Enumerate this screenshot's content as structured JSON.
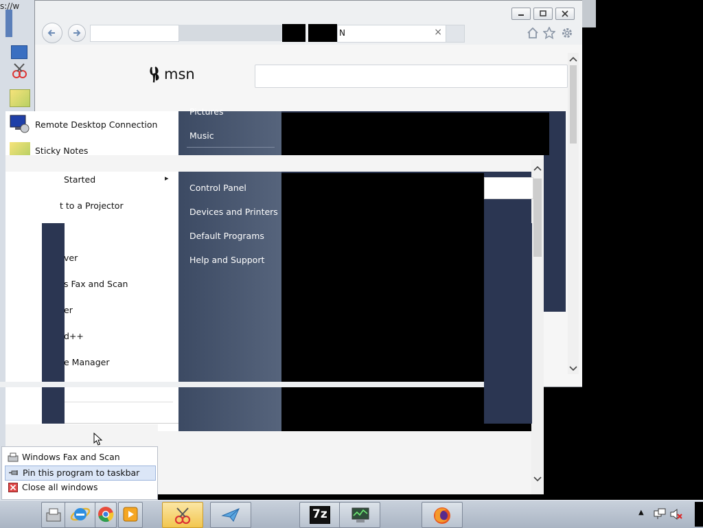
{
  "address_fragment": "s://w",
  "browser": {
    "tab_title_fragment": "N",
    "tab_close_glyph": "×",
    "brand": "msn"
  },
  "start_menu": {
    "programs": [
      {
        "label": "Remote Desktop Connection",
        "icon": "remote-desktop-icon"
      },
      {
        "label": "Sticky Notes",
        "icon": "sticky-notes-icon"
      },
      {
        "label": "Started",
        "icon": "getting-started-icon",
        "has_submenu": true
      },
      {
        "label": "t to a Projector",
        "icon": "projector-icon"
      },
      {
        "label": "ver",
        "icon": "program-icon"
      },
      {
        "label": "s Fax and Scan",
        "icon": "fax-icon"
      },
      {
        "label": "er",
        "icon": "program-icon"
      },
      {
        "label": "d++",
        "icon": "program-icon"
      },
      {
        "label": "e Manager",
        "icon": "program-icon"
      }
    ],
    "submenu_arrow": "▸",
    "places": [
      {
        "label": "Pictures"
      },
      {
        "label": "Music"
      },
      {
        "label": "Control Panel"
      },
      {
        "label": "Devices and Printers"
      },
      {
        "label": "Default Programs"
      },
      {
        "label": "Help and Support"
      }
    ]
  },
  "jump_list": {
    "items": [
      {
        "label": "Windows Fax and Scan",
        "icon": "fax-icon",
        "highlighted": false
      },
      {
        "label": "Pin this program to taskbar",
        "icon": "pin-icon",
        "highlighted": true
      },
      {
        "label": "Close all windows",
        "icon": "close-icon",
        "highlighted": false
      }
    ]
  },
  "taskbar": {
    "apps": [
      {
        "name": "fax-scan",
        "icon": "fax-icon",
        "active": false
      },
      {
        "name": "internet-explorer",
        "icon": "ie-icon",
        "active": false
      },
      {
        "name": "chrome",
        "icon": "chrome-icon",
        "active": false
      },
      {
        "name": "media-player",
        "icon": "media-player-icon",
        "active": false
      },
      {
        "name": "snipping-tool",
        "icon": "snipping-tool-icon",
        "active": true
      },
      {
        "name": "paper-plane",
        "icon": "paper-plane-icon",
        "active": false
      },
      {
        "name": "7-zip",
        "icon": "7zip-icon",
        "active": false
      },
      {
        "name": "task-manager",
        "icon": "task-manager-icon",
        "active": false
      },
      {
        "name": "firefox",
        "icon": "firefox-icon",
        "active": false
      }
    ],
    "seven_zip_label": "7z"
  },
  "colors": {
    "navy": "#2b3652",
    "highlight": "#dbe6f7",
    "snip_active": "#f2c64f"
  }
}
